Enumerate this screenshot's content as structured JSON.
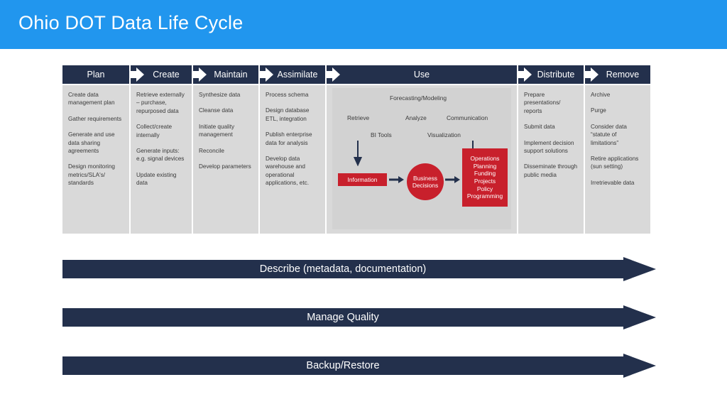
{
  "header": {
    "title": "Ohio DOT Data Life Cycle",
    "background_color": "#2196ee",
    "text_color": "#ffffff"
  },
  "colors": {
    "navy": "#23304c",
    "blue": "#2196ee",
    "red": "#c8202c",
    "panel_gray": "#d9d9d9",
    "inner_gray": "#d2d2d2",
    "body_text": "#3a3a3a"
  },
  "stages": [
    {
      "key": "plan",
      "label": "Plan",
      "items": [
        "Create data management plan",
        "Gather requirements",
        "Generate and use data sharing agreements",
        "Design monitoring metrics/SLA's/ standards"
      ]
    },
    {
      "key": "create",
      "label": "Create",
      "items": [
        "Retrieve externally – purchase, repurposed data",
        "Collect/create internally",
        "Generate inputs: e.g. signal devices",
        "Update existing data"
      ]
    },
    {
      "key": "maintain",
      "label": "Maintain",
      "items": [
        "Synthesize data",
        "Cleanse data",
        "Initiate quality management",
        "Reconcile",
        "Develop parameters"
      ]
    },
    {
      "key": "assimilate",
      "label": "Assimilate",
      "items": [
        "Process schema",
        "Design database ETL, integration",
        "Publish enterprise data for analysis",
        "Develop data warehouse and operational applications, etc."
      ]
    },
    {
      "key": "use",
      "label": "Use",
      "items": []
    },
    {
      "key": "distribute",
      "label": "Distribute",
      "items": [
        "Prepare presentations/ reports",
        "Submit data",
        "Implement decision support solutions",
        "Disseminate through public media"
      ]
    },
    {
      "key": "remove",
      "label": "Remove",
      "items": [
        "Archive",
        "Purge",
        "Consider data “statute of limitations”",
        "Retire applications (sun setting)",
        "Irretrievable data"
      ]
    }
  ],
  "use_panel": {
    "forecasting": "Forecasting/Modeling",
    "retrieve": "Retrieve",
    "analyze": "Analyze",
    "communication": "Communication",
    "bi_tools": "BI Tools",
    "visualization": "Visualization",
    "information": "Information",
    "business_decisions_line1": "Business",
    "business_decisions_line2": "Decisions",
    "outcomes": [
      "Operations",
      "Planning",
      "Funding",
      "Projects",
      "Policy",
      "Programming"
    ]
  },
  "banners": [
    {
      "key": "describe",
      "label": "Describe (metadata, documentation)"
    },
    {
      "key": "quality",
      "label": "Manage Quality"
    },
    {
      "key": "backup",
      "label": "Backup/Restore"
    }
  ]
}
